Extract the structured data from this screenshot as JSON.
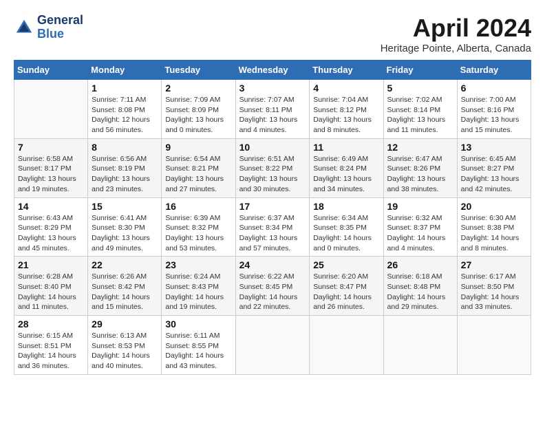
{
  "header": {
    "logo_line1": "General",
    "logo_line2": "Blue",
    "month_title": "April 2024",
    "location": "Heritage Pointe, Alberta, Canada"
  },
  "weekdays": [
    "Sunday",
    "Monday",
    "Tuesday",
    "Wednesday",
    "Thursday",
    "Friday",
    "Saturday"
  ],
  "weeks": [
    [
      {
        "day": "",
        "info": ""
      },
      {
        "day": "1",
        "info": "Sunrise: 7:11 AM\nSunset: 8:08 PM\nDaylight: 12 hours\nand 56 minutes."
      },
      {
        "day": "2",
        "info": "Sunrise: 7:09 AM\nSunset: 8:09 PM\nDaylight: 13 hours\nand 0 minutes."
      },
      {
        "day": "3",
        "info": "Sunrise: 7:07 AM\nSunset: 8:11 PM\nDaylight: 13 hours\nand 4 minutes."
      },
      {
        "day": "4",
        "info": "Sunrise: 7:04 AM\nSunset: 8:12 PM\nDaylight: 13 hours\nand 8 minutes."
      },
      {
        "day": "5",
        "info": "Sunrise: 7:02 AM\nSunset: 8:14 PM\nDaylight: 13 hours\nand 11 minutes."
      },
      {
        "day": "6",
        "info": "Sunrise: 7:00 AM\nSunset: 8:16 PM\nDaylight: 13 hours\nand 15 minutes."
      }
    ],
    [
      {
        "day": "7",
        "info": "Sunrise: 6:58 AM\nSunset: 8:17 PM\nDaylight: 13 hours\nand 19 minutes."
      },
      {
        "day": "8",
        "info": "Sunrise: 6:56 AM\nSunset: 8:19 PM\nDaylight: 13 hours\nand 23 minutes."
      },
      {
        "day": "9",
        "info": "Sunrise: 6:54 AM\nSunset: 8:21 PM\nDaylight: 13 hours\nand 27 minutes."
      },
      {
        "day": "10",
        "info": "Sunrise: 6:51 AM\nSunset: 8:22 PM\nDaylight: 13 hours\nand 30 minutes."
      },
      {
        "day": "11",
        "info": "Sunrise: 6:49 AM\nSunset: 8:24 PM\nDaylight: 13 hours\nand 34 minutes."
      },
      {
        "day": "12",
        "info": "Sunrise: 6:47 AM\nSunset: 8:26 PM\nDaylight: 13 hours\nand 38 minutes."
      },
      {
        "day": "13",
        "info": "Sunrise: 6:45 AM\nSunset: 8:27 PM\nDaylight: 13 hours\nand 42 minutes."
      }
    ],
    [
      {
        "day": "14",
        "info": "Sunrise: 6:43 AM\nSunset: 8:29 PM\nDaylight: 13 hours\nand 45 minutes."
      },
      {
        "day": "15",
        "info": "Sunrise: 6:41 AM\nSunset: 8:30 PM\nDaylight: 13 hours\nand 49 minutes."
      },
      {
        "day": "16",
        "info": "Sunrise: 6:39 AM\nSunset: 8:32 PM\nDaylight: 13 hours\nand 53 minutes."
      },
      {
        "day": "17",
        "info": "Sunrise: 6:37 AM\nSunset: 8:34 PM\nDaylight: 13 hours\nand 57 minutes."
      },
      {
        "day": "18",
        "info": "Sunrise: 6:34 AM\nSunset: 8:35 PM\nDaylight: 14 hours\nand 0 minutes."
      },
      {
        "day": "19",
        "info": "Sunrise: 6:32 AM\nSunset: 8:37 PM\nDaylight: 14 hours\nand 4 minutes."
      },
      {
        "day": "20",
        "info": "Sunrise: 6:30 AM\nSunset: 8:38 PM\nDaylight: 14 hours\nand 8 minutes."
      }
    ],
    [
      {
        "day": "21",
        "info": "Sunrise: 6:28 AM\nSunset: 8:40 PM\nDaylight: 14 hours\nand 11 minutes."
      },
      {
        "day": "22",
        "info": "Sunrise: 6:26 AM\nSunset: 8:42 PM\nDaylight: 14 hours\nand 15 minutes."
      },
      {
        "day": "23",
        "info": "Sunrise: 6:24 AM\nSunset: 8:43 PM\nDaylight: 14 hours\nand 19 minutes."
      },
      {
        "day": "24",
        "info": "Sunrise: 6:22 AM\nSunset: 8:45 PM\nDaylight: 14 hours\nand 22 minutes."
      },
      {
        "day": "25",
        "info": "Sunrise: 6:20 AM\nSunset: 8:47 PM\nDaylight: 14 hours\nand 26 minutes."
      },
      {
        "day": "26",
        "info": "Sunrise: 6:18 AM\nSunset: 8:48 PM\nDaylight: 14 hours\nand 29 minutes."
      },
      {
        "day": "27",
        "info": "Sunrise: 6:17 AM\nSunset: 8:50 PM\nDaylight: 14 hours\nand 33 minutes."
      }
    ],
    [
      {
        "day": "28",
        "info": "Sunrise: 6:15 AM\nSunset: 8:51 PM\nDaylight: 14 hours\nand 36 minutes."
      },
      {
        "day": "29",
        "info": "Sunrise: 6:13 AM\nSunset: 8:53 PM\nDaylight: 14 hours\nand 40 minutes."
      },
      {
        "day": "30",
        "info": "Sunrise: 6:11 AM\nSunset: 8:55 PM\nDaylight: 14 hours\nand 43 minutes."
      },
      {
        "day": "",
        "info": ""
      },
      {
        "day": "",
        "info": ""
      },
      {
        "day": "",
        "info": ""
      },
      {
        "day": "",
        "info": ""
      }
    ]
  ]
}
